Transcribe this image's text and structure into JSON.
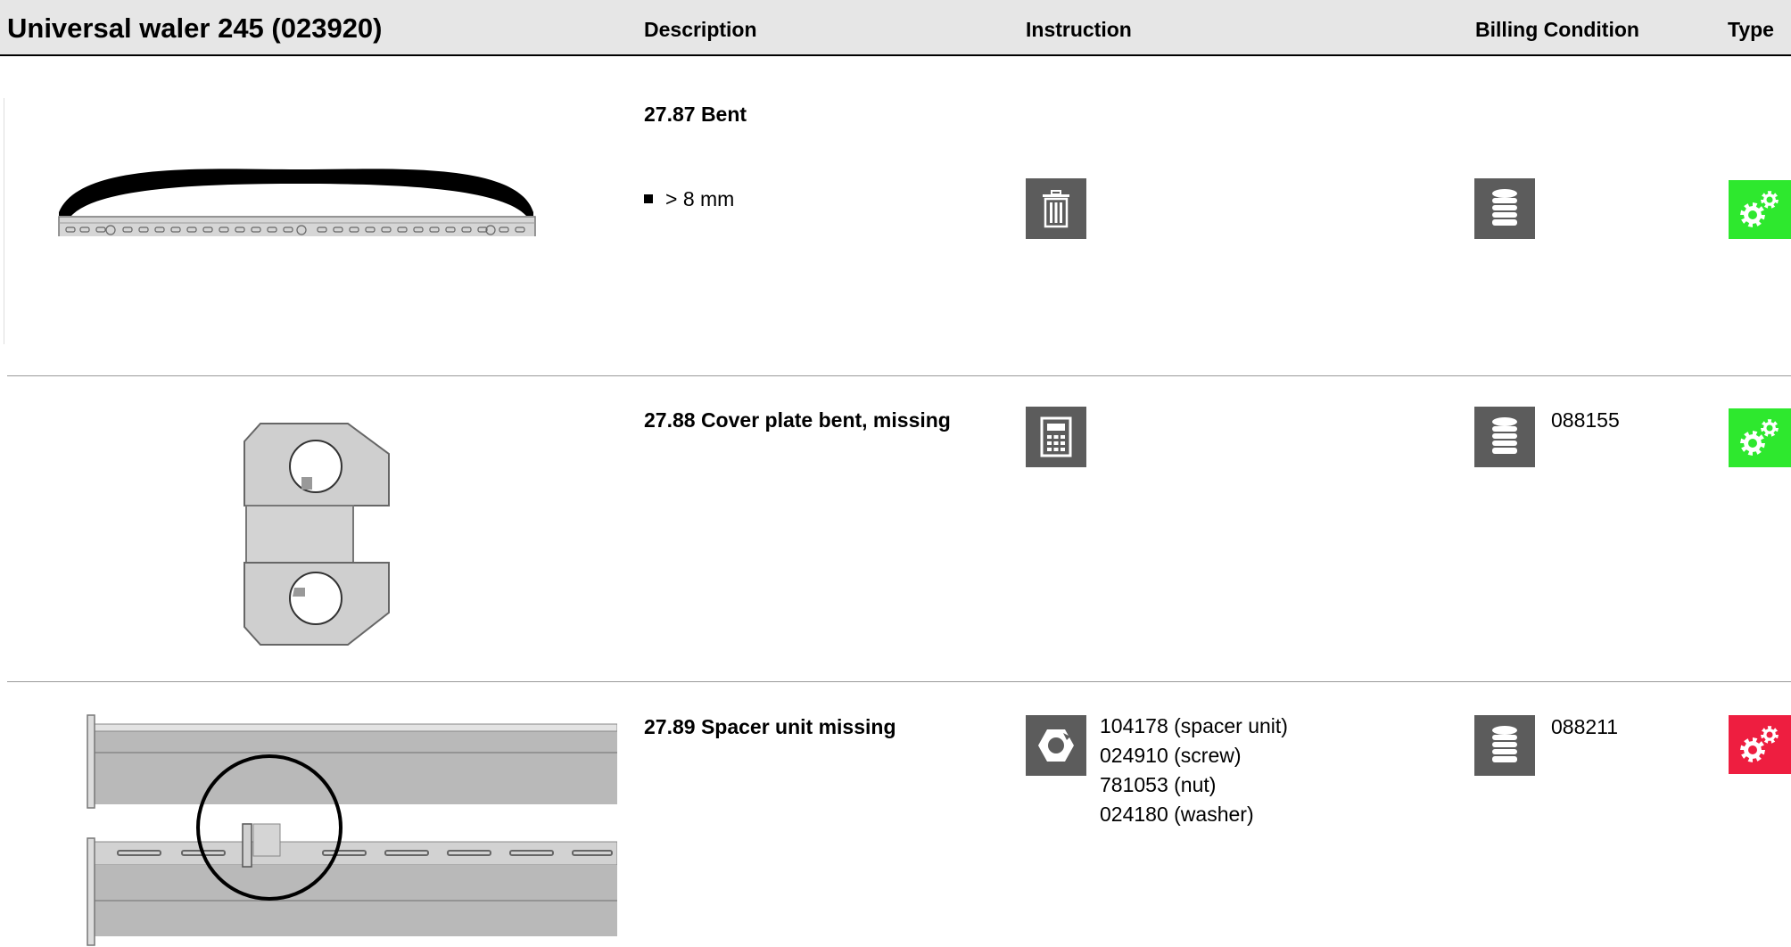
{
  "header": {
    "title": "Universal waler 245 (023920)",
    "col_description": "Description",
    "col_instruction": "Instruction",
    "col_billing": "Billing Condition",
    "col_type": "Type"
  },
  "rows": [
    {
      "title": "27.87 Bent",
      "bullet": "> 8 mm",
      "instruction_icon": "trash-icon",
      "billing_icon": "coin-stack-icon",
      "billing_code": "",
      "type_icon": "gears-icon",
      "type_color": "#2ee82e"
    },
    {
      "title": "27.88 Cover plate bent, missing",
      "instruction_icon": "calculator-icon",
      "billing_icon": "coin-stack-icon",
      "billing_code": "088155",
      "type_icon": "gears-icon",
      "type_color": "#2ee82e"
    },
    {
      "title": "27.89 Spacer unit missing",
      "instruction_icon": "nut-icon",
      "parts": [
        "104178 (spacer unit)",
        "024910 (screw)",
        "781053 (nut)",
        "024180 (washer)"
      ],
      "billing_icon": "coin-stack-icon",
      "billing_code": "088211",
      "type_icon": "gears-icon",
      "type_color": "#ee1e40"
    }
  ]
}
